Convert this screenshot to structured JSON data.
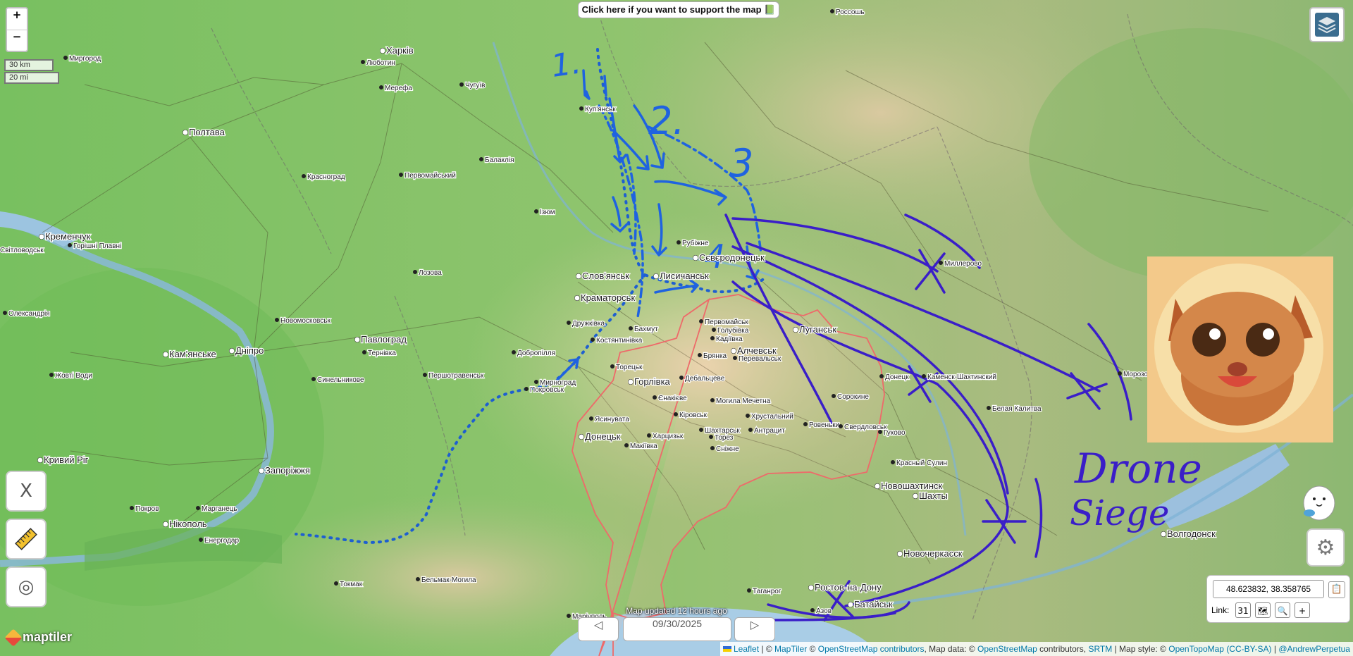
{
  "controls": {
    "zoom_in": "+",
    "zoom_out": "−",
    "scale_km": "30 km",
    "scale_mi": "20 mi",
    "support_button": "Click here if you want to support the map 📗",
    "layers_icon": "layers-icon",
    "tool_x": "X",
    "tool_ruler": "ruler-icon",
    "tool_target": "◎",
    "settings_icon": "⚙"
  },
  "coords": {
    "value": "48.623832, 38.358765",
    "copy_icon": "📋",
    "link_label": "Link:",
    "link_icons": [
      "31",
      "🗺",
      "🔍",
      "+"
    ]
  },
  "timeline": {
    "updated": "Map updated 12 hours ago",
    "date": "09/30/2025",
    "prev": "◁",
    "next": "▷"
  },
  "attribution": {
    "leaflet": "Leaflet",
    "sep1": " | © ",
    "maptiler": "MapTiler",
    "sep2": " © ",
    "osm": "OpenStreetMap contributors",
    "mid": ", Map data: © ",
    "osm2": "OpenStreetMap",
    "mid2": " contributors, ",
    "srtm": "SRTM",
    "mid3": " | Map style: © ",
    "otm": "OpenTopoMap",
    "cc": "(CC-BY-SA)",
    "sep3": " | ",
    "author": "@AndrewPerpetua"
  },
  "logo": "maptiler",
  "annotations": {
    "n1": "1.",
    "n2": "2.",
    "n3": "3",
    "n4": "4",
    "drone": "Drone",
    "siege": "Siege"
  },
  "cities": [
    {
      "name": "Харків",
      "big": true
    },
    {
      "name": "Полтава",
      "big": true
    },
    {
      "name": "Кременчук",
      "big": true
    },
    {
      "name": "Дніпро",
      "big": true
    },
    {
      "name": "Кам'янське",
      "big": true
    },
    {
      "name": "Павлоград",
      "big": true
    },
    {
      "name": "Запоріжжя",
      "big": true
    },
    {
      "name": "Кривий Ріг",
      "big": true
    },
    {
      "name": "Нікополь",
      "big": true
    },
    {
      "name": "Слов'янськ",
      "big": true
    },
    {
      "name": "Краматорськ",
      "big": true
    },
    {
      "name": "Лисичанськ",
      "big": true
    },
    {
      "name": "Сєвєродонецьк",
      "big": true
    },
    {
      "name": "Горлівка",
      "big": true
    },
    {
      "name": "Донецьк",
      "big": true
    },
    {
      "name": "Макіївка",
      "big": false
    },
    {
      "name": "Алчевськ",
      "big": true
    },
    {
      "name": "Луганськ",
      "big": true
    },
    {
      "name": "Маріуполь",
      "big": false
    },
    {
      "name": "Таганрог",
      "big": false
    },
    {
      "name": "Ростов-на-Дону",
      "big": true
    },
    {
      "name": "Батайськ",
      "big": true
    },
    {
      "name": "Новочеркасск",
      "big": true
    },
    {
      "name": "Шахты",
      "big": true
    },
    {
      "name": "Новошахтинск",
      "big": true
    },
    {
      "name": "Волгодонск",
      "big": true
    },
    {
      "name": "Миргород",
      "big": false
    },
    {
      "name": "Люботин",
      "big": false
    },
    {
      "name": "Мерефа",
      "big": false
    },
    {
      "name": "Чугуїв",
      "big": false
    },
    {
      "name": "Куп'янськ",
      "big": false
    },
    {
      "name": "Балаклія",
      "big": false
    },
    {
      "name": "Красноград",
      "big": false
    },
    {
      "name": "Первомайський",
      "big": false
    },
    {
      "name": "Ізюм",
      "big": false
    },
    {
      "name": "Лозова",
      "big": false
    },
    {
      "name": "Горішні Плавні",
      "big": false
    },
    {
      "name": "Олександрія",
      "big": false
    },
    {
      "name": "Новомосковськ",
      "big": false
    },
    {
      "name": "Тернівка",
      "big": false
    },
    {
      "name": "Синельникове",
      "big": false
    },
    {
      "name": "Першотравенськ",
      "big": false
    },
    {
      "name": "Жовті Води",
      "big": false
    },
    {
      "name": "Добропілля",
      "big": false
    },
    {
      "name": "Дружківка",
      "big": false
    },
    {
      "name": "Костянтинівка",
      "big": false
    },
    {
      "name": "Бахмут",
      "big": false
    },
    {
      "name": "Торецьк",
      "big": false
    },
    {
      "name": "Покровськ",
      "big": false
    },
    {
      "name": "Мирноград",
      "big": false
    },
    {
      "name": "Рубіжне",
      "big": false
    },
    {
      "name": "Первомайськ",
      "big": false
    },
    {
      "name": "Голубівка",
      "big": false
    },
    {
      "name": "Кадіївка",
      "big": false
    },
    {
      "name": "Брянка",
      "big": false
    },
    {
      "name": "Перевальськ",
      "big": false
    },
    {
      "name": "Дебальцеве",
      "big": false
    },
    {
      "name": "Єнакієве",
      "big": false
    },
    {
      "name": "Могила Мечетна",
      "big": false
    },
    {
      "name": "Кіровськ",
      "big": false
    },
    {
      "name": "Хрустальний",
      "big": false
    },
    {
      "name": "Сорокине",
      "big": false
    },
    {
      "name": "Ясинувата",
      "big": false
    },
    {
      "name": "Харцизьк",
      "big": false
    },
    {
      "name": "Шахтарськ",
      "big": false
    },
    {
      "name": "Торез",
      "big": false
    },
    {
      "name": "Сніжне",
      "big": false
    },
    {
      "name": "Антрацит",
      "big": false
    },
    {
      "name": "Ровеньки",
      "big": false
    },
    {
      "name": "Свердловськ",
      "big": false
    },
    {
      "name": "Гуково",
      "big": false
    },
    {
      "name": "Красный Сулин",
      "big": false
    },
    {
      "name": "Каменск-Шахтинский",
      "big": false
    },
    {
      "name": "Донецк",
      "big": false
    },
    {
      "name": "Белая Калитва",
      "big": false
    },
    {
      "name": "Миллерово",
      "big": false
    },
    {
      "name": "Морозовск",
      "big": false
    },
    {
      "name": "Россошь",
      "big": false
    },
    {
      "name": "Покров",
      "big": false
    },
    {
      "name": "Марганець",
      "big": false
    },
    {
      "name": "Енергодар",
      "big": false
    },
    {
      "name": "Токмак",
      "big": false
    },
    {
      "name": "Бельмак-Могила",
      "big": false
    },
    {
      "name": "Азов",
      "big": false
    },
    {
      "name": "Світловодськ",
      "big": false
    }
  ]
}
